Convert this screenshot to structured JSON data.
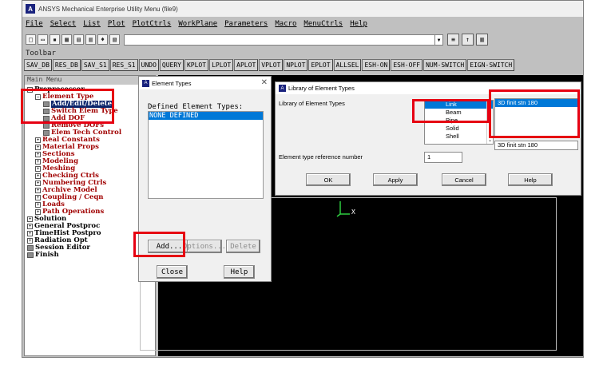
{
  "window": {
    "title": "ANSYS Mechanical Enterprise Utility Menu (file9)"
  },
  "menubar": [
    "File",
    "Select",
    "List",
    "Plot",
    "PlotCtrls",
    "WorkPlane",
    "Parameters",
    "Macro",
    "MenuCtrls",
    "Help"
  ],
  "toolbar": {
    "label": "Toolbar",
    "buttons": [
      "SAV_DB",
      "RES_DB",
      "SAV_S1",
      "RES_S1",
      "UNDO",
      "QUERY",
      "KPLOT",
      "LPLOT",
      "APLOT",
      "VPLOT",
      "NPLOT",
      "EPLOT",
      "ALLSEL",
      "ESH-ON",
      "ESH-OFF",
      "NUM-SWITCH",
      "EIGN-SWITCH"
    ]
  },
  "main_menu": {
    "title": "Main Menu",
    "preprocessor": "Preprocessor",
    "element_type": "Element Type",
    "add_edit_delete": "Add/Edit/Delete",
    "switch_elem_type": "Switch Elem Type",
    "add_dof": "Add DOF",
    "remove_dofs": "Remove DOFs",
    "elem_tech_control": "Elem Tech Control",
    "pre_items": [
      "Real Constants",
      "Material Props",
      "Sections",
      "Modeling",
      "Meshing",
      "Checking Ctrls",
      "Numbering Ctrls",
      "Archive Model",
      "Coupling / Ceqn",
      "Loads",
      "Path Operations"
    ],
    "top_items": [
      "Solution",
      "General Postproc",
      "TimeHist Postpro",
      "Radiation Opt"
    ],
    "session_editor": "Session Editor",
    "finish": "Finish"
  },
  "element_types_dialog": {
    "title": "Element Types",
    "defined_label": "Defined Element Types:",
    "defined_items": [
      "NONE DEFINED"
    ],
    "add_label": "Add...",
    "options_label": "Options...",
    "delete_label": "Delete",
    "close_label": "Close",
    "help_label": "Help"
  },
  "library_dialog": {
    "title": "Library of Element Types",
    "library_label": "Library of Element Types",
    "categories": [
      "Link",
      "Beam",
      "Pipe",
      "Solid",
      "Shell"
    ],
    "selected_category": "Link",
    "elements": [
      "3D finit stn 180"
    ],
    "selected_element": "3D finit stn 180",
    "element_field": "3D finit stn 180",
    "ref_label": "Element type reference number",
    "ref_value": "1",
    "ok_label": "OK",
    "apply_label": "Apply",
    "cancel_label": "Cancel",
    "help_label": "Help"
  },
  "triad": {
    "x_label": "X"
  },
  "colors": {
    "highlight": "#e60012",
    "selection": "#0078d7",
    "graphics_bg": "#000000",
    "menu_red": "#a00000"
  }
}
